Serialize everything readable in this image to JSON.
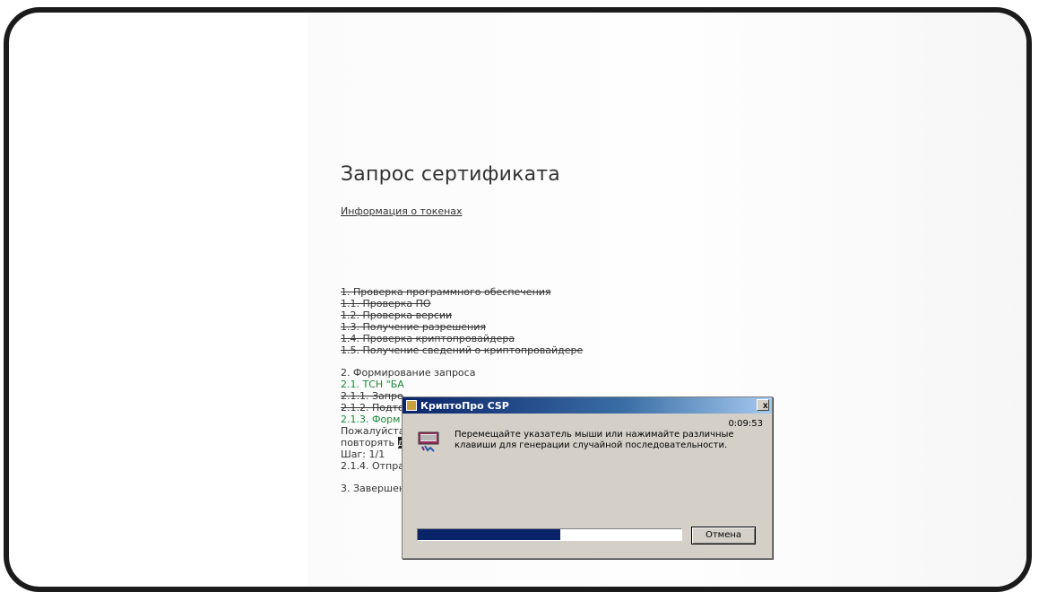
{
  "page": {
    "title": "Запрос сертификата",
    "token_link": "Информация о токенах",
    "steps": {
      "s1": "1. Проверка программного обеспечения",
      "s1_1": "1.1. Проверка ПО",
      "s1_2": "1.2. Проверка версии",
      "s1_3": "1.3. Получение разрешения",
      "s1_4": "1.4. Проверка криптопровайдера",
      "s1_5": "1.5. Получение сведений о криптопровайдере",
      "s2": "2. Формирование запроса",
      "s2_1": "2.1. ТСН \"БА",
      "s2_1_1": "2.1.1. Запро",
      "s2_1_2": "2.1.2. Подто",
      "s2_1_3": "2.1.3. Форм",
      "please": "Пожалуйста,",
      "repeat_prefix": "повторять ",
      "repeat_highlight": "д",
      "step_count": "Шаг: 1/1",
      "s2_1_4": "2.1.4. Отпра",
      "s3": "3. Завершен"
    }
  },
  "dialog": {
    "title": "КриптоПро CSP",
    "timer": "0:09:53",
    "message": "Перемещайте указатель мыши или нажимайте различные клавиши для генерации случайной последовательности.",
    "cancel_label": "Отмена",
    "close_glyph": "x",
    "progress": 0.54,
    "icon": "keyboard-icon"
  }
}
